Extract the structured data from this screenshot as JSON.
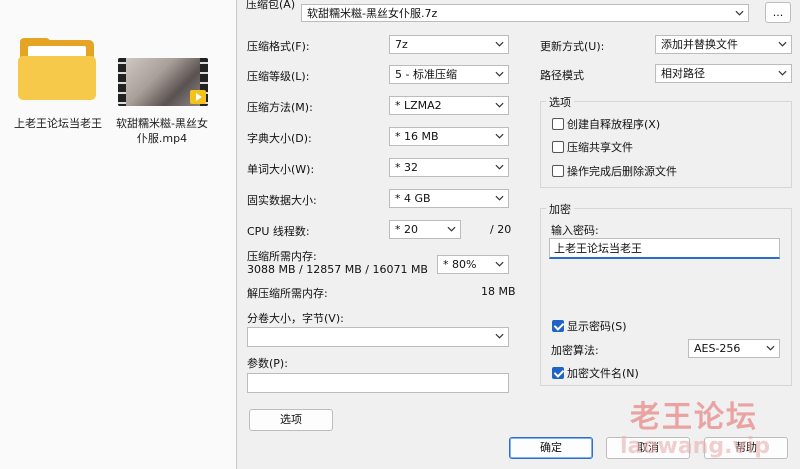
{
  "desktop": {
    "folder_label": "上老王论坛当老王",
    "video_label": "软甜糯米糍-黑丝女仆服.mp4"
  },
  "dialog": {
    "archive_label": "压缩包(A)",
    "archive_value": "软甜糯米糍-黑丝女仆服.7z",
    "browse_label": "...",
    "format_label": "压缩格式(F):",
    "format_value": "7z",
    "level_label": "压缩等级(L):",
    "level_value": "5 - 标准压缩",
    "method_label": "压缩方法(M):",
    "method_value": "* LZMA2",
    "dict_label": "字典大小(D):",
    "dict_value": "* 16 MB",
    "word_label": "单词大小(W):",
    "word_value": "* 32",
    "solid_label": "固实数据大小:",
    "solid_value": "* 4 GB",
    "threads_label": "CPU 线程数:",
    "threads_value": "* 20",
    "threads_total": "/ 20",
    "mem_label": "压缩所需内存:",
    "mem_detail": "3088 MB / 12857 MB / 16071 MB",
    "mem_percent": "* 80%",
    "decomp_label": "解压缩所需内存:",
    "decomp_value": "18 MB",
    "split_label": "分卷大小，字节(V):",
    "params_label": "参数(P):",
    "options_button": "选项",
    "update_label": "更新方式(U):",
    "update_value": "添加并替换文件",
    "path_label": "路径模式",
    "path_value": "相对路径",
    "options_group": "选项",
    "opt_sfx": "创建自释放程序(X)",
    "opt_shared": "压缩共享文件",
    "opt_delete": "操作完成后删除源文件",
    "encrypt_group": "加密",
    "password_label": "输入密码:",
    "password_value": "上老王论坛当老王",
    "show_password": "显示密码(S)",
    "algo_label": "加密算法:",
    "algo_value": "AES-256",
    "encrypt_names": "加密文件名(N)",
    "ok_button": "确定",
    "cancel_button": "取消",
    "help_button": "帮助"
  },
  "watermark": {
    "line1": "老王论坛",
    "line2": "laowang.vip"
  }
}
